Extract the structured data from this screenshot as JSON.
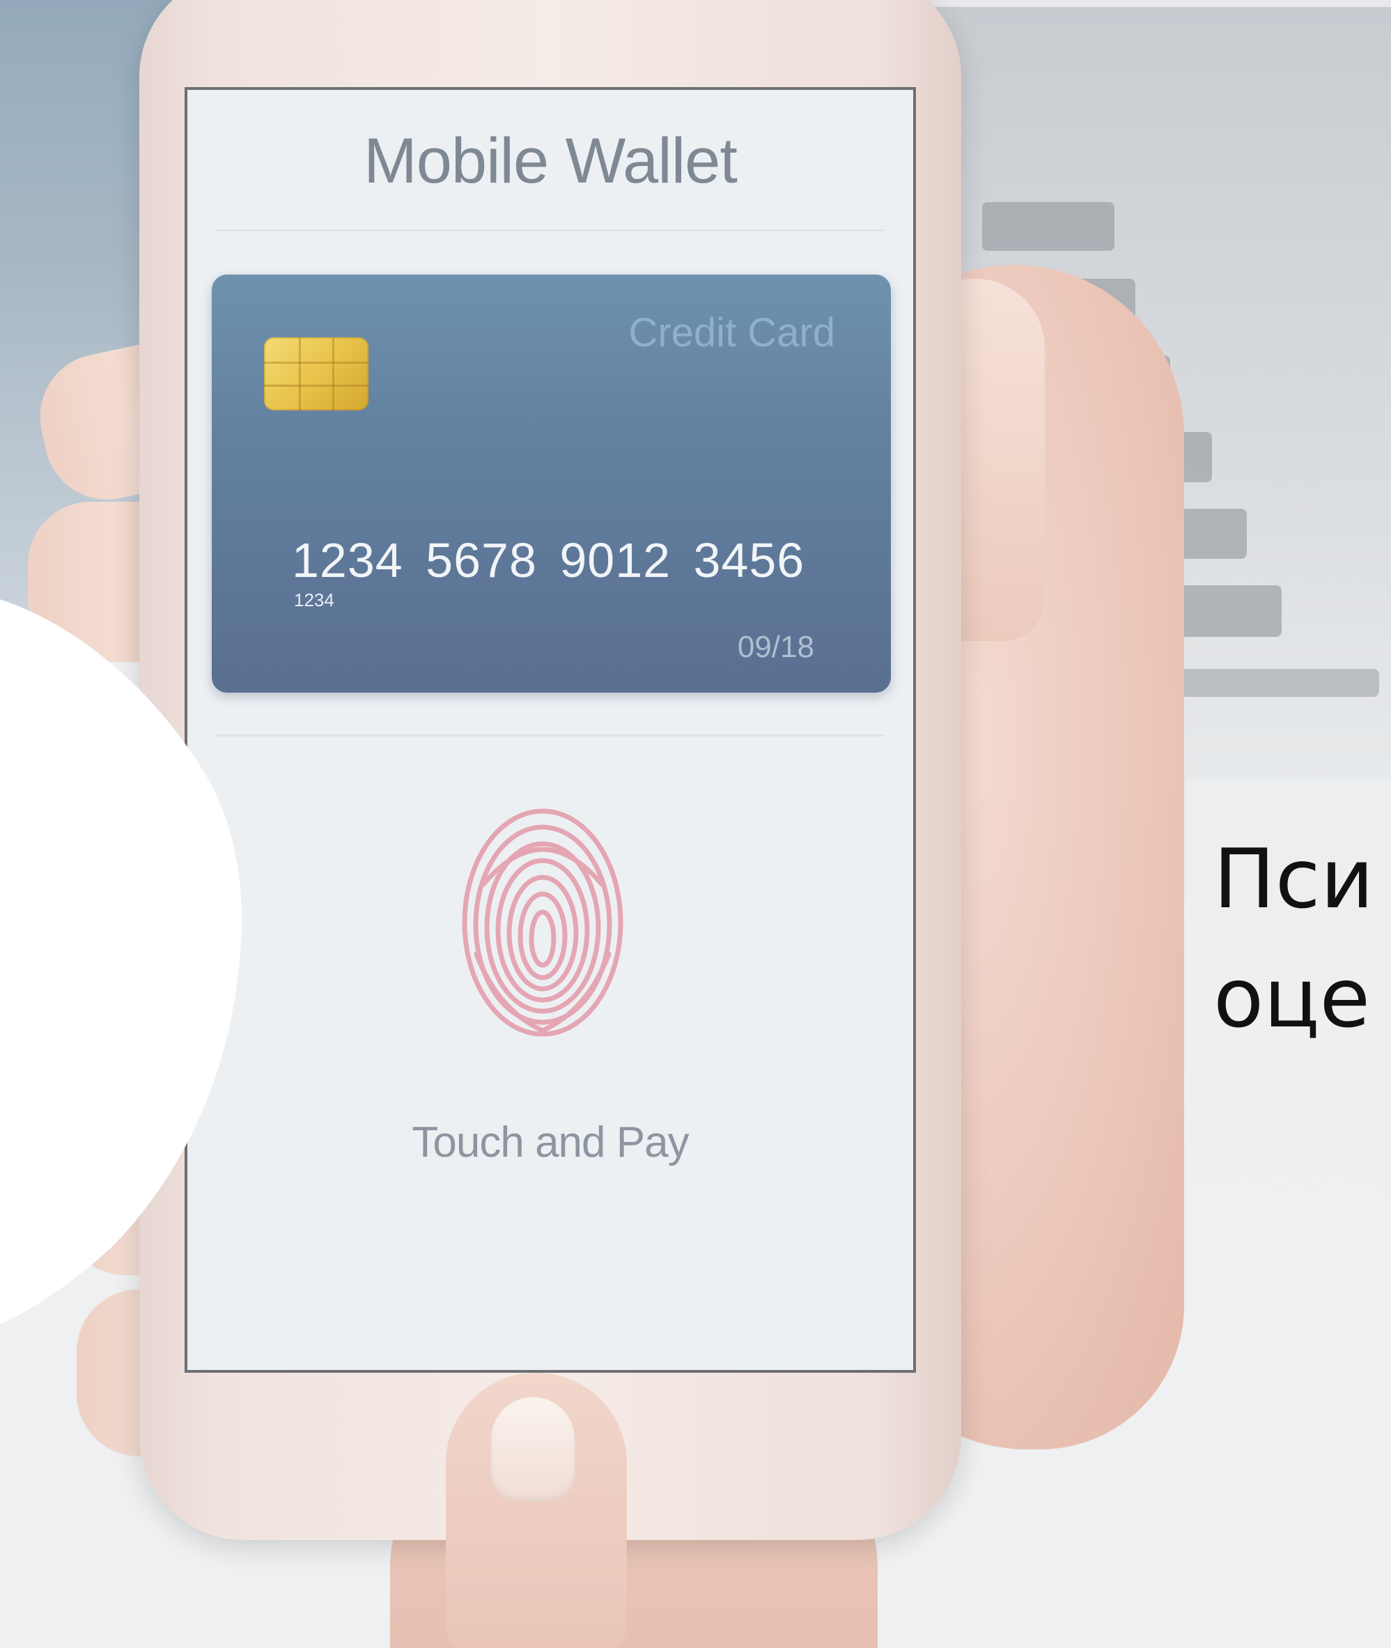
{
  "screen": {
    "title": "Mobile Wallet",
    "card": {
      "brand_label": "Credit Card",
      "number": "1234  5678  9012  3456",
      "sub_number": "1234",
      "expiry": "09/18"
    },
    "action_label": "Touch and Pay"
  },
  "overlay_text": {
    "line1": "Пси",
    "line2": "оце"
  },
  "colors": {
    "card_top": "#6e92ae",
    "card_bottom": "#5a6f92",
    "chip": "#e9c34a",
    "fingerprint": "#e39aa8",
    "caption": "#111111"
  },
  "icons": [
    "fingerprint-icon",
    "card-chip-icon"
  ]
}
